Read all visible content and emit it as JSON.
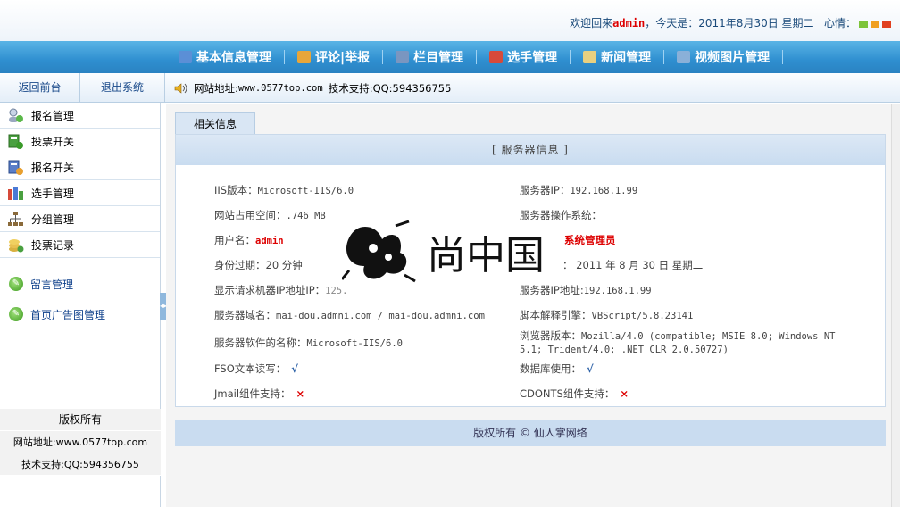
{
  "header": {
    "welcome_prefix": "欢迎回来",
    "username": "admin",
    "today": "，今天是：2011年8月30日  星期二",
    "mood_label": "心情：",
    "mood_colors": [
      "#7cc43a",
      "#f0a020",
      "#e04020"
    ]
  },
  "nav": {
    "items": [
      {
        "label": "基本信息管理",
        "icon": "info-doc-icon",
        "color": "#5b8fd6"
      },
      {
        "label": "评论|举报",
        "icon": "comment-icon",
        "color": "#e8a63a"
      },
      {
        "label": "栏目管理",
        "icon": "column-grid-icon",
        "color": "#7a96c0"
      },
      {
        "label": "选手管理",
        "icon": "players-icon",
        "color": "#d64a3a"
      },
      {
        "label": "新闻管理",
        "icon": "news-icon",
        "color": "#e8d080"
      },
      {
        "label": "视频图片管理",
        "icon": "image-icon",
        "color": "#8ab0d8"
      }
    ]
  },
  "subbar": {
    "back_label": "返回前台",
    "logout_label": "退出系统",
    "notice_label": "网站地址:",
    "notice_url": "www.0577top.com",
    "notice_support": "技术支持:QQ:594356755"
  },
  "sidebar": {
    "items": [
      {
        "label": "报名管理",
        "icon": "signup-manage-icon"
      },
      {
        "label": "投票开关",
        "icon": "vote-switch-icon"
      },
      {
        "label": "报名开关",
        "icon": "signup-switch-icon"
      },
      {
        "label": "选手管理",
        "icon": "players-icon"
      },
      {
        "label": "分组管理",
        "icon": "group-tree-icon"
      },
      {
        "label": "投票记录",
        "icon": "vote-record-icon"
      }
    ],
    "links": [
      {
        "label": "留言管理"
      },
      {
        "label": "首页广告图管理"
      }
    ],
    "copyright": {
      "title": "版权所有",
      "site": "网站地址:www.0577top.com",
      "support": "技术支持:QQ:594356755"
    }
  },
  "main": {
    "tab_label": "相关信息",
    "panel_title": "[ 服务器信息 ]",
    "info": {
      "iis_label": "IIS版本：",
      "iis_value": "Microsoft-IIS/6.0",
      "server_ip_label": "服务器IP：",
      "server_ip_value": "192.168.1.99",
      "space_label": "网站占用空间：",
      "space_value": ".746 MB",
      "os_label": "服务器操作系统：",
      "os_value": "",
      "user_label": "用户名：",
      "user_value": "admin",
      "role_value": "系统管理员",
      "expire_label": "身份过期：",
      "expire_value": "20 分钟",
      "date_value": "：  2011 年 8 月 30 日  星期二",
      "req_ip_label": "显示请求机器IP地址IP：",
      "req_ip_value": "125.",
      "server_ip2_label": "服务器IP地址:",
      "server_ip2_value": "192.168.1.99",
      "domain_label": "服务器域名：",
      "domain_value": "mai-dou.admni.com / mai-dou.admni.com",
      "script_label": "脚本解释引擎：",
      "script_value": "VBScript/5.8.23141",
      "software_label": "服务器软件的名称：",
      "software_value": "Microsoft-IIS/6.0",
      "browser_label": "浏览器版本：",
      "browser_value_1": "Mozilla/4.0 (compatible; MSIE 8.0; Windows NT",
      "browser_value_2": "5.1; Trident/4.0; .NET CLR 2.0.50727)",
      "fso_label": "FSO文本读写：",
      "fso_value": "√",
      "db_label": "数据库使用：",
      "db_value": "√",
      "jmail_label": "Jmail组件支持：",
      "jmail_value": "×",
      "cdonts_label": "CDONTS组件支持：",
      "cdonts_value": "×"
    },
    "footer_text": "版权所有  ©  仙人掌网络",
    "watermark_text": "尚中国"
  }
}
